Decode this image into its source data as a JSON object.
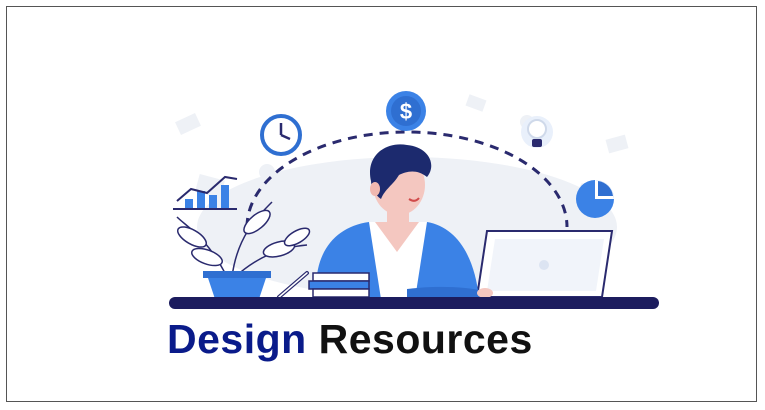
{
  "banner": {
    "title_word_1": "Design",
    "title_word_2": "Resources"
  },
  "icons": [
    "dollar-icon",
    "clock-icon",
    "lightbulb-icon",
    "pie-chart-icon",
    "bar-chart-icon",
    "plant-icon",
    "laptop-icon",
    "books-icon",
    "person-illustration"
  ],
  "colors": {
    "title_primary": "#0a1b8a",
    "title_secondary": "#111111",
    "accent_blue": "#3b82e6",
    "navy": "#1c1c5e",
    "frame_border": "#555555"
  }
}
